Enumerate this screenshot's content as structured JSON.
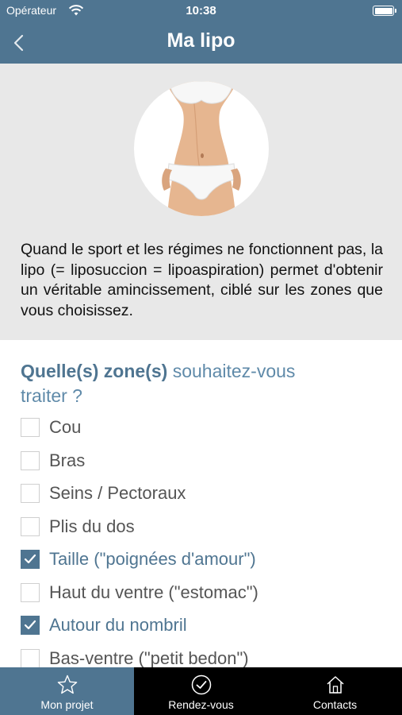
{
  "status": {
    "carrier": "Opérateur",
    "time": "10:38"
  },
  "nav": {
    "title": "Ma lipo",
    "back_icon": "chevron-left-icon"
  },
  "intro": "Quand le sport et les régimes ne fonctionnent pas, la lipo (= liposuccion = lipoaspiration) permet d'obtenir un véritable amincissement, ciblé sur les zones que vous choisissez.",
  "question": {
    "strong": "Quelle(s) zone(s)",
    "rest": " souhaitez-vous traiter ?"
  },
  "options": [
    {
      "label": "Cou",
      "checked": false
    },
    {
      "label": "Bras",
      "checked": false
    },
    {
      "label": "Seins / Pectoraux",
      "checked": false
    },
    {
      "label": "Plis du dos",
      "checked": false
    },
    {
      "label": "Taille (\"poignées d'amour\")",
      "checked": true
    },
    {
      "label": "Haut du ventre (\"estomac\")",
      "checked": false
    },
    {
      "label": "Autour du nombril",
      "checked": true
    },
    {
      "label": "Bas-ventre (\"petit bedon\")",
      "checked": false
    }
  ],
  "tabs": [
    {
      "label": "Mon projet",
      "icon": "star-icon",
      "active": true
    },
    {
      "label": "Rendez-vous",
      "icon": "check-circle-icon",
      "active": false
    },
    {
      "label": "Contacts",
      "icon": "home-icon",
      "active": false
    }
  ],
  "colors": {
    "primary": "#4f7591",
    "hero_bg": "#e8e8e8",
    "tabbar_bg": "#000000"
  }
}
